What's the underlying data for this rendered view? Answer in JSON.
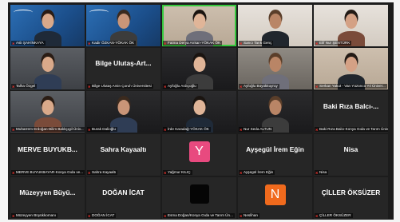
{
  "meeting": {
    "tiles": [
      {
        "name": "Aslı ŞAHİNKAYA",
        "kind": "video",
        "bg": "bg-blue"
      },
      {
        "name": "Kadir ÖZKAN-YÖKAK ÖK",
        "kind": "video",
        "bg": "bg-blue"
      },
      {
        "name": "Fatma Derya Arıkan-YÖKAK ÖK",
        "kind": "video",
        "bg": "bg-warm",
        "active": true
      },
      {
        "name": "Sarıcı Tarık Genç",
        "kind": "video",
        "bg": "bg-light"
      },
      {
        "name": "Elif Nur ŞENTÜRK",
        "kind": "video",
        "bg": "bg-light"
      },
      {
        "name": "Talha Özgel",
        "kind": "video",
        "bg": "bg-office"
      },
      {
        "name": "Bilge Ulutaş Amin Çoruh Üniversitesi",
        "big": "Bilge Ulutaş-Art...",
        "kind": "name"
      },
      {
        "name": "Ayfoğlu Ardıçoğlu",
        "kind": "video",
        "bg": "bg-dark"
      },
      {
        "name": "Ayfoğlu Büyükkuyruy",
        "kind": "video",
        "bg": "bg-room"
      },
      {
        "name": "Serkan Yakut - Van Yüzüncü Yıl Üniver...",
        "kind": "video",
        "bg": "bg-warm"
      },
      {
        "name": "Muharrem Erdoğan-Bilim Balıkçıgil Üniv...",
        "kind": "video",
        "bg": "bg-office"
      },
      {
        "name": "Burak Dalioğlu",
        "kind": "video",
        "bg": "bg-dark"
      },
      {
        "name": "İrde Karadağ-YÖKAK ÖK",
        "kind": "video",
        "bg": "bg-dark"
      },
      {
        "name": "Nur Seda ALTUN",
        "kind": "video",
        "bg": "bg-dark"
      },
      {
        "name": "Baki Rıza Balcı-Konya Gıda ve Tarım Üniv...",
        "big": "Baki Rıza Balcı-...",
        "kind": "name"
      },
      {
        "name": "MERVE BUYUKBAYAR-Konya Gıda ve...",
        "big": "MERVE BUYUKB...",
        "kind": "name"
      },
      {
        "name": "Sahra Kayaaltı",
        "big": "Sahra Kayaaltı",
        "kind": "name"
      },
      {
        "name": "Yağmur KILIÇ",
        "kind": "avatar",
        "letter": "Y",
        "color": "pink"
      },
      {
        "name": "Ayşegül İrem Eğin",
        "big": "Ayşegül İrem Eğin",
        "kind": "name"
      },
      {
        "name": "Nisa",
        "big": "Nisa",
        "kind": "name"
      },
      {
        "name": "Müzeyyen Büyükkomanı",
        "big": "Müzeyyen Büyü...",
        "kind": "name"
      },
      {
        "name": "DOĞAN İCAT",
        "big": "DOĞAN İCAT",
        "kind": "name"
      },
      {
        "name": "Esma Doğan/Konya Gıda ve Tarım Ün...",
        "kind": "avatar",
        "letter": "",
        "color": "black"
      },
      {
        "name": "Neslihan",
        "kind": "avatar",
        "letter": "N",
        "color": "orange"
      },
      {
        "name": "ÇİLLER ÖKSÜZER",
        "big": "ÇİLLER ÖKSÜZER",
        "kind": "name"
      }
    ]
  }
}
